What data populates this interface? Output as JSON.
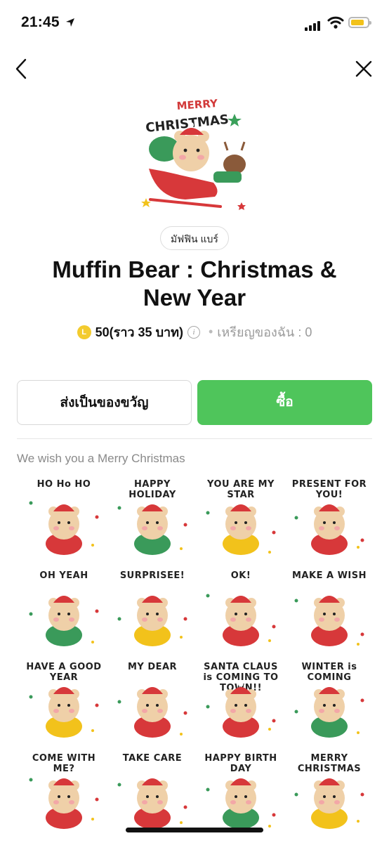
{
  "status_bar": {
    "time": "21:45"
  },
  "product": {
    "author": "มัฟฟิน แบร์",
    "title": "Muffin Bear : Christmas & New Year",
    "coin_symbol": "L",
    "price": "50(ราว 35 บาท)",
    "info_symbol": "i",
    "separator": "•",
    "my_coins": "เหรียญของฉัน : 0"
  },
  "hero_text": {
    "line1": "MERRY",
    "line2": "CHRISTMAS"
  },
  "actions": {
    "gift_label": "ส่งเป็นของขวัญ",
    "buy_label": "ซื้อ"
  },
  "tagline": "We wish you a Merry Christmas",
  "colors": {
    "brand_green": "#4fc55b",
    "coin_yellow": "#f3cb2e"
  },
  "stickers": [
    {
      "caption": "HO Ho HO"
    },
    {
      "caption": "HAPPY HOLIDAY"
    },
    {
      "caption": "YOU ARE MY STAR"
    },
    {
      "caption": "PRESENT FOR YOU!"
    },
    {
      "caption": "OH YEAH"
    },
    {
      "caption": "SURPRISEE!"
    },
    {
      "caption": "OK!"
    },
    {
      "caption": "MAKE A WISH"
    },
    {
      "caption": "HAVE A GOOD YEAR"
    },
    {
      "caption": "MY DEAR"
    },
    {
      "caption": "SANTA CLAUS is COMING TO TOWN!!"
    },
    {
      "caption": "WINTER is COMING"
    },
    {
      "caption": "COME WITH ME?"
    },
    {
      "caption": "TAKE CARE"
    },
    {
      "caption": "HAPPY BIRTH DAY"
    },
    {
      "caption": "MERRY CHRISTMAS"
    }
  ]
}
